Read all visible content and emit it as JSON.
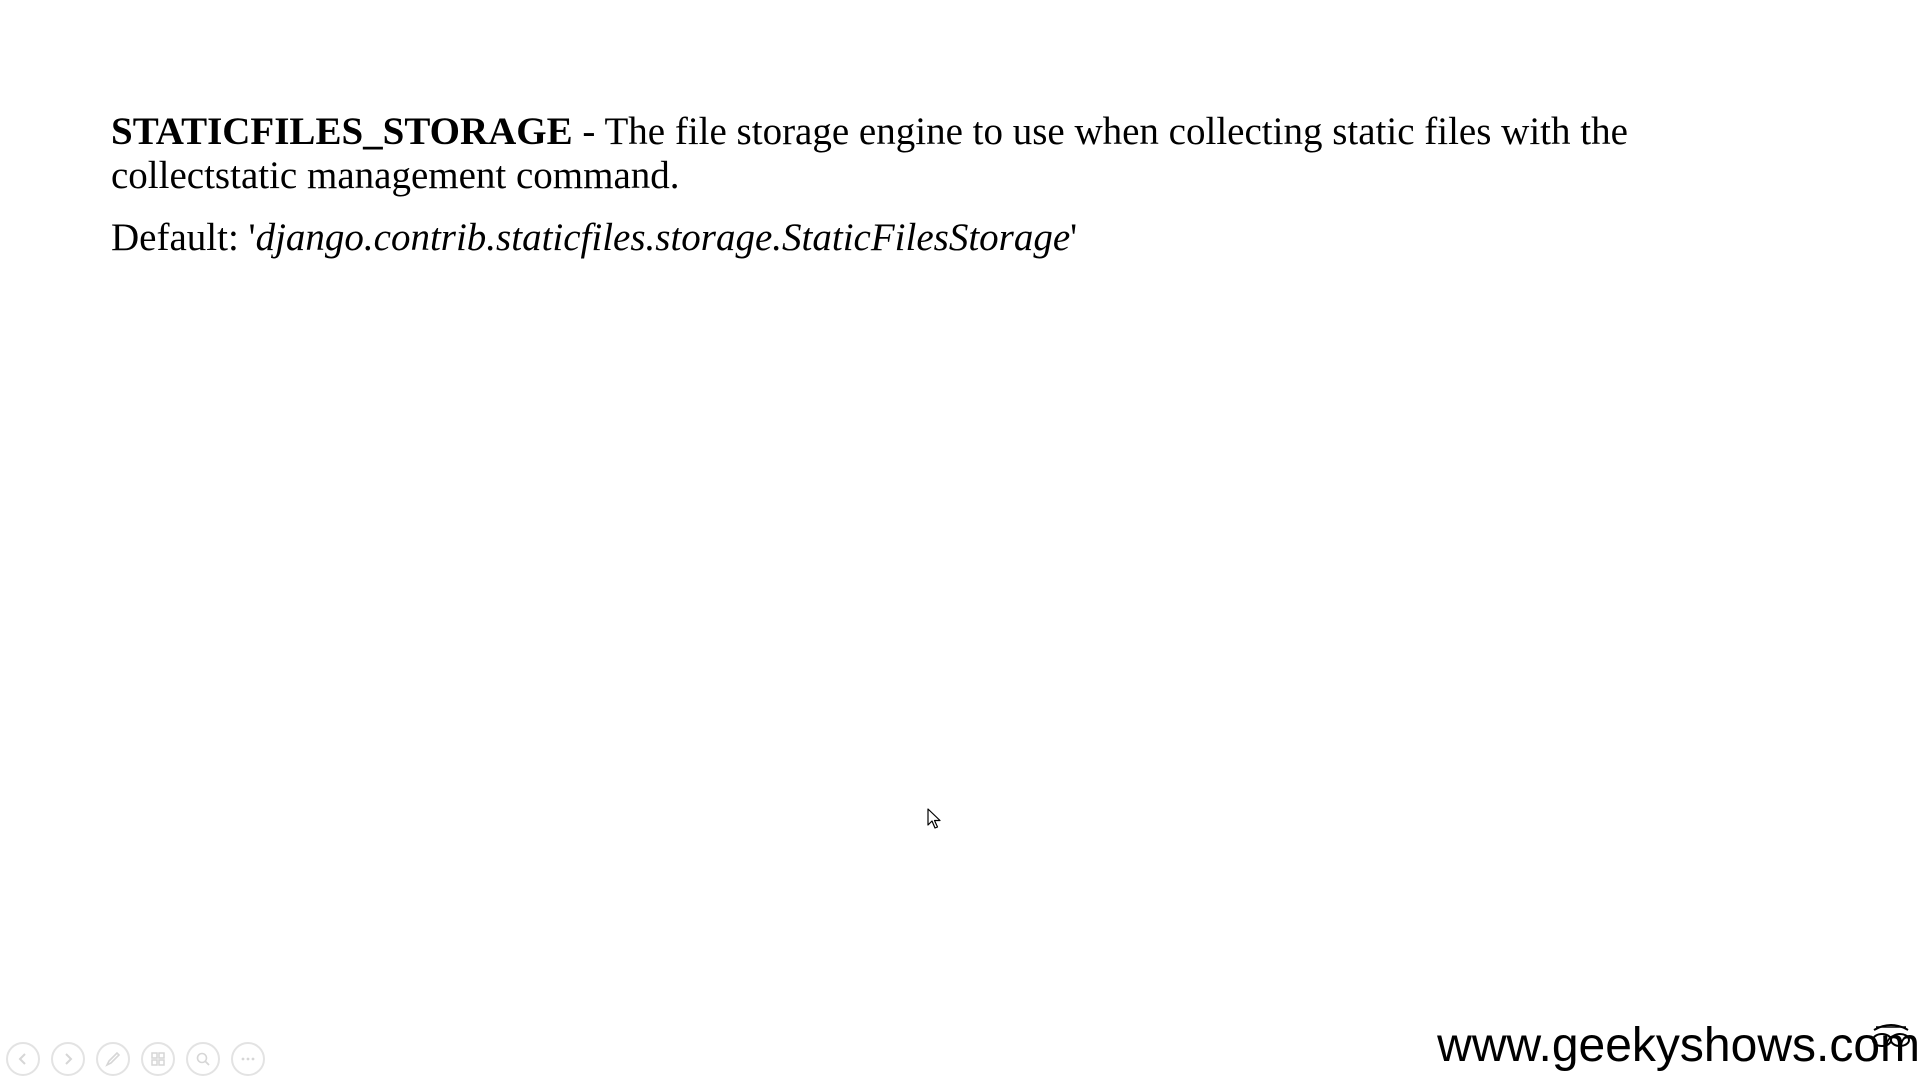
{
  "slide": {
    "term": "STATICFILES_STORAGE",
    "description": " - The file storage engine to use when collecting static files with the collectstatic management command.",
    "default_label": "Default: '",
    "default_value": "django.contrib.staticfiles.storage.StaticFilesStorage",
    "default_suffix": "'"
  },
  "watermark": {
    "text": "www.geekyshows.com"
  },
  "toolbar": {
    "icons": [
      "previous-icon",
      "next-icon",
      "pen-icon",
      "slides-grid-icon",
      "zoom-icon",
      "more-options-icon"
    ]
  },
  "colors": {
    "background": "#ffffff",
    "text": "#000000",
    "toolbar_icon": "#e3e3e3"
  }
}
